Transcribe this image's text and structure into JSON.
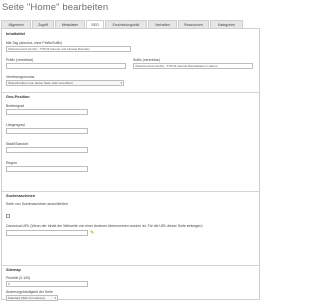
{
  "page": {
    "title": "Seite \"Home\" bearbeiten"
  },
  "tabs": [
    {
      "label": "Allgemein"
    },
    {
      "label": "Zugriff"
    },
    {
      "label": "Metadaten"
    },
    {
      "label": "SEO"
    },
    {
      "label": "Erscheinungsbild"
    },
    {
      "label": "Verhalten"
    },
    {
      "label": "Ressourcen"
    },
    {
      "label": "Kategorien"
    }
  ],
  "inhaltstitel": {
    "heading": "Inhaltstitel",
    "title_label": "title-Tag (absolut, ohne Präfix/Suffix)",
    "title_value": "VisionConnect GmbH - TYPO3 Internet und Intranet Dienstlei",
    "prefix_label": "Präfix (vererbbar)",
    "prefix_value": "",
    "suffix_label": "Suffix (vererbbar)",
    "suffix_value": "VisionConnect GmbH - TYPO3 Internet Dienstleister in Hanno",
    "mode_label": "Vererbungsmodus",
    "mode_value": "Überschreiben (von dieser Seite nicht vererbbar)"
  },
  "geo": {
    "heading": "Geo-Position",
    "lat_label": "Breitengrad",
    "lat_value": "",
    "lon_label": "Längengrad",
    "lon_value": "",
    "city_label": "Stadt/Standort",
    "city_value": "",
    "region_label": "Region",
    "region_value": ""
  },
  "search": {
    "heading": "Suchmaschinen",
    "exclude_label": "Seite von Suchmaschinen ausschließen",
    "canonical_label": "Canonical URL (Wenn der Inhalt der Webseite von einer Anderen übernommen worden ist. Für die URL dieser Seite eintragen)",
    "canonical_value": ""
  },
  "sitemap": {
    "heading": "Sitemap",
    "priority_label": "Priorität (0-100)",
    "priority_value": "0",
    "freq_label": "Änderungshäufigkeit der Seite",
    "freq_value": "Standard (Wert Konstanten)"
  },
  "icons": {
    "checkbox": "checkbox-icon",
    "chevron": "chevron-down-icon"
  }
}
